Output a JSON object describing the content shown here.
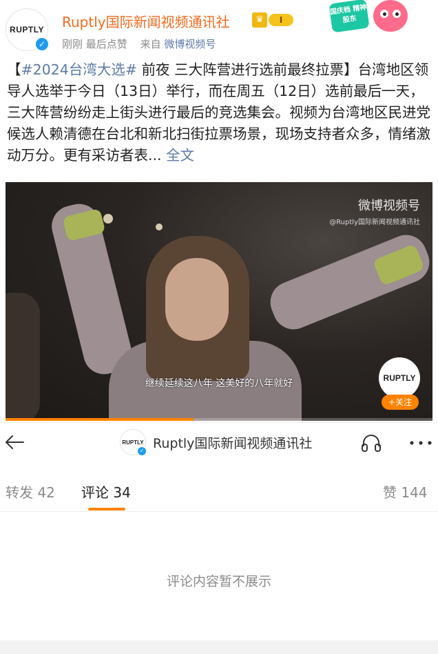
{
  "header": {
    "avatar_text": "RUPTLY",
    "account_name": "Ruptly国际新闻视频通讯社",
    "vip_crown": "♛",
    "vip_level": "I",
    "time": "刚刚",
    "edited_label": "最后点赞",
    "via_label": "来自",
    "source": "微博视频号",
    "sticker_text": "国庆档 精神股东"
  },
  "post": {
    "bracket_open": "【",
    "hashtag": "#2024台湾大选#",
    "body": " 前夜 三大阵营进行选前最终拉票】台湾地区领导人选举于今日（13日）举行，而在周五（12日）选前最后一天，三大阵营纷纷走上街头进行最后的竞选集会。视频为台湾地区民进党候选人赖清德在台北和新北扫街拉票场景，现场支持者众多，情绪激动万分。更有采访者表...",
    "more_label": " 全文"
  },
  "video": {
    "watermark_main": "微博视频号",
    "watermark_sub": "@Ruptly国际新闻视频通讯社",
    "subtitle": "继续延续这八年 这美好的八年就好",
    "logo_text": "RUPTLY",
    "follow_label": "+关注",
    "progress": 0.44
  },
  "nav": {
    "avatar_text": "RUPTLY",
    "title": "Ruptly国际新闻视频通讯社"
  },
  "tabs": {
    "repost": "转发 42",
    "comment": "评论 34",
    "like": "赞 144"
  },
  "comments": {
    "empty_text": "评论内容暂不展示"
  },
  "colors": {
    "accent": "#ff8200",
    "account_name": "#f26a1b",
    "link": "#5b7aa6",
    "verified": "#1e9bf0"
  }
}
